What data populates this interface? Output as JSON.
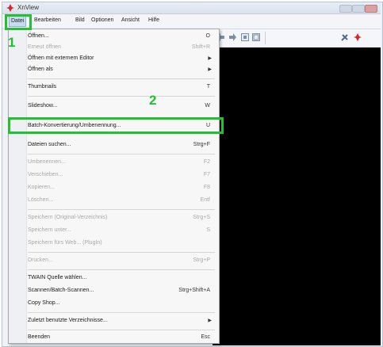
{
  "window": {
    "title": "XnView"
  },
  "menubar": {
    "items": [
      "Datei",
      "Bearbeiten",
      "Bild",
      "Optionen",
      "Ansicht",
      "Hilfe"
    ]
  },
  "annotations": {
    "step1": "1",
    "step2": "2",
    "highlight_color": "#22c132"
  },
  "file_menu": {
    "items": [
      {
        "label": "Öffnen...",
        "shortcut": "O",
        "disabled": false
      },
      {
        "label": "Erneut öffnen",
        "shortcut": "Shift+R",
        "disabled": true
      },
      {
        "label": "Öffnen mit externem Editor",
        "shortcut": "",
        "submenu": true,
        "disabled": false
      },
      {
        "label": "Öffnen als",
        "shortcut": "",
        "submenu": true,
        "disabled": false
      },
      {
        "label": "Thumbnails",
        "shortcut": "T",
        "disabled": false
      },
      {
        "label": "Slideshow...",
        "shortcut": "W",
        "disabled": false
      },
      {
        "label": "Batch-Konvertierung/Umbenennung...",
        "shortcut": "U",
        "disabled": false
      },
      {
        "label": "Dateien suchen...",
        "shortcut": "Strg+F",
        "disabled": false
      },
      {
        "label": "Umbenennen...",
        "shortcut": "F2",
        "disabled": true
      },
      {
        "label": "Verschieben...",
        "shortcut": "F7",
        "disabled": true
      },
      {
        "label": "Kopieren...",
        "shortcut": "F8",
        "disabled": true
      },
      {
        "label": "Löschen...",
        "shortcut": "Entf",
        "disabled": true
      },
      {
        "label": "Speichern (Original-Verzeichnis)",
        "shortcut": "Strg+S",
        "disabled": true
      },
      {
        "label": "Speichern unter...",
        "shortcut": "S",
        "disabled": true
      },
      {
        "label": "Speichern fürs Web... (PlugIn)",
        "shortcut": "",
        "disabled": true
      },
      {
        "label": "Drucken...",
        "shortcut": "Strg+P",
        "disabled": true
      },
      {
        "label": "TWAIN Quelle wählen...",
        "shortcut": "",
        "disabled": false
      },
      {
        "label": "Scannen/Batch-Scannen...",
        "shortcut": "Strg+Shift+A",
        "disabled": false
      },
      {
        "label": "Copy Shop...",
        "shortcut": "",
        "disabled": false
      },
      {
        "label": "Zuletzt benutzte Verzeichnisse...",
        "shortcut": "",
        "submenu": true,
        "disabled": false
      },
      {
        "label": "Beenden",
        "shortcut": "Esc",
        "disabled": false
      }
    ]
  }
}
